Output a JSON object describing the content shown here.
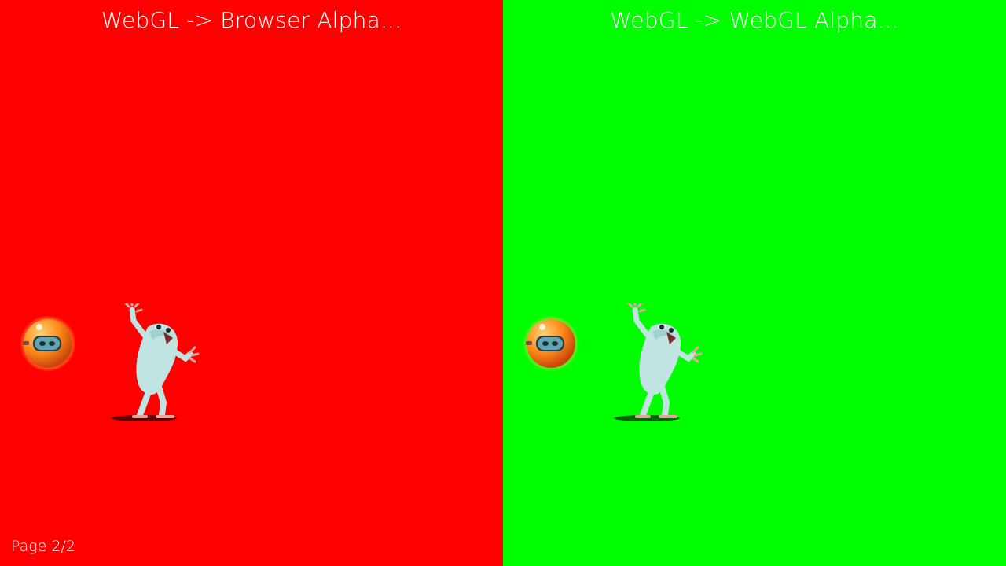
{
  "panels": [
    {
      "title": "WebGL -> Browser Alpha...",
      "background": "#ff0000",
      "sprites": [
        "robot-ball-icon",
        "monster-character-icon"
      ]
    },
    {
      "title": "WebGL -> WebGL Alpha...",
      "background": "#00ff00",
      "sprites": [
        "robot-ball-icon",
        "monster-character-icon"
      ]
    }
  ],
  "footer": {
    "page_indicator": "Page 2/2"
  },
  "colors": {
    "text": "#ffffff",
    "robot_orange": "#ff8c1a",
    "creature_body": "#bfe4e2"
  }
}
